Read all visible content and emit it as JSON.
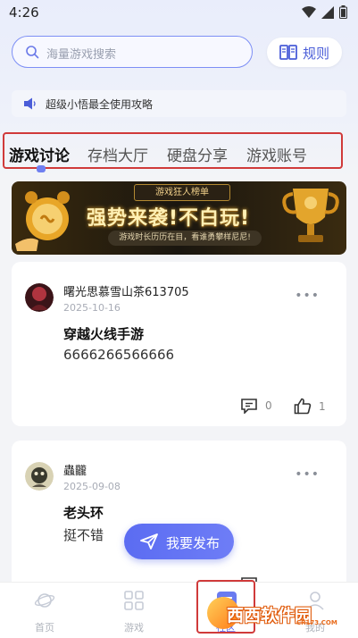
{
  "status": {
    "time": "4:26"
  },
  "search": {
    "placeholder": "海量游戏搜索"
  },
  "rules": {
    "label": "规则"
  },
  "notice": {
    "text": "超级小悟最全使用攻略"
  },
  "tabs": [
    {
      "label": "游戏讨论",
      "active": true
    },
    {
      "label": "存档大厅",
      "active": false
    },
    {
      "label": "硬盘分享",
      "active": false
    },
    {
      "label": "游戏账号",
      "active": false
    }
  ],
  "banner": {
    "top_label": "游戏狂人榜单",
    "headline": "强势来袭!不白玩!",
    "subline": "游戏时长历历在目，看谁勇攀样尼尼!"
  },
  "posts": [
    {
      "username": "曙光思慕雪山茶613705",
      "date": "2025-10-16",
      "title": "穿越火线手游",
      "body": "6666266566666",
      "comments": "0",
      "likes": "1"
    },
    {
      "username": "蟲龖",
      "date": "2025-09-08",
      "title": "老头环",
      "body": "挺不错"
    }
  ],
  "publish": {
    "label": "我要发布"
  },
  "bottom_nav": [
    {
      "label": "首页",
      "icon": "planet-icon"
    },
    {
      "label": "游戏",
      "icon": "grid-icon"
    },
    {
      "label": "社区",
      "icon": "community-icon",
      "active": true
    },
    {
      "label": "我的",
      "icon": "profile-icon"
    }
  ],
  "watermark": {
    "text": "西西软件园",
    "sub": "CR173.COM"
  },
  "colors": {
    "accent": "#5b6cf2",
    "highlight_box": "#d03a3a",
    "banner_gold": "#f1d08a"
  }
}
